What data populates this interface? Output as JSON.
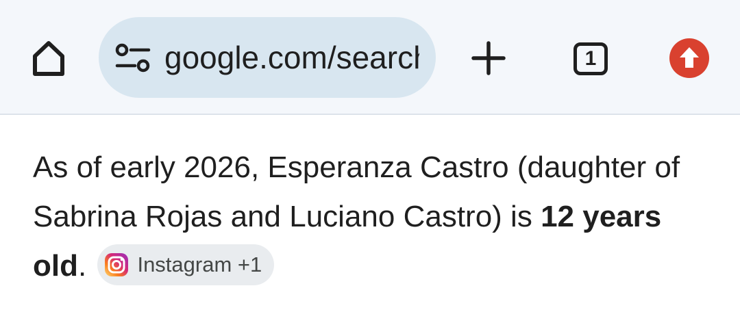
{
  "browser": {
    "url": "google.com/search",
    "tab_count": "1",
    "icons": {
      "home": "home-icon",
      "site_info": "tune-icon",
      "new_tab": "plus-icon",
      "tab_switcher": "tab-switcher-icon",
      "update": "update-arrow-icon"
    },
    "colors": {
      "toolbar_bg": "#f4f7fb",
      "omnibox_bg": "#d8e6f0",
      "update_badge": "#d9412f"
    }
  },
  "answer": {
    "text_before": "As of early 2026, Esperanza Castro (daughter of Sabrina Rojas and Luciano Castro) is ",
    "bold_text": "12 years old",
    "text_after": ".",
    "source_chip": {
      "label": "Instagram +1",
      "icon": "instagram-icon"
    }
  }
}
